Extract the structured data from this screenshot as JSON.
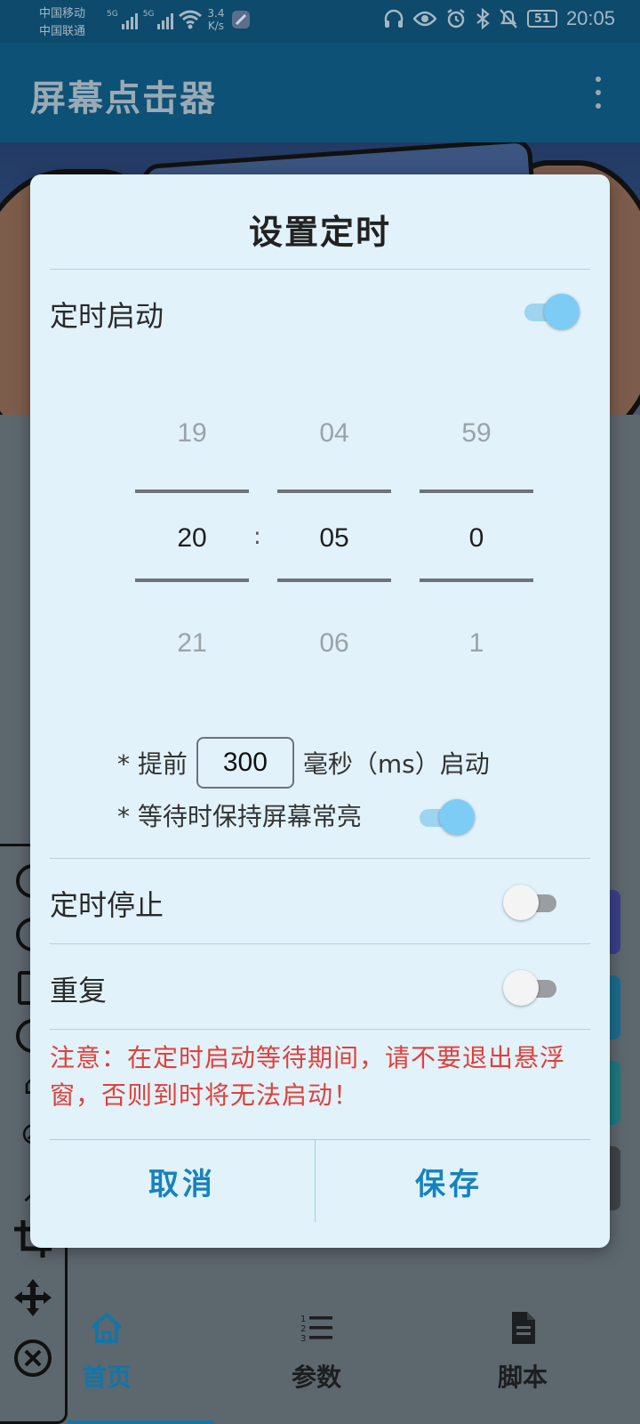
{
  "status_bar": {
    "carrier_1": "中国移动",
    "carrier_2": "中国联通",
    "net_1": "5G",
    "net_2": "5G",
    "speed_value": "3.4",
    "speed_unit": "K/s",
    "battery": "51",
    "time": "20:05",
    "icons": [
      "headphones-icon",
      "eye-icon",
      "alarm-icon",
      "bluetooth-icon",
      "mute-icon"
    ]
  },
  "app_bar": {
    "title": "屏幕点击器",
    "menu_icon": "more-vert-icon"
  },
  "dialog": {
    "title": "设置定时",
    "timed_start": {
      "label": "定时启动",
      "on": true
    },
    "picker": {
      "hours": {
        "above": "19",
        "selected": "20",
        "below": "21"
      },
      "minutes": {
        "above": "04",
        "selected": "05",
        "below": "06"
      },
      "seconds": {
        "above": "59",
        "selected": "0",
        "below": "1"
      },
      "separator": ":"
    },
    "advance": {
      "prefix": "* 提前",
      "value": "300",
      "suffix": "毫秒（ms）启动"
    },
    "keep_awake": {
      "label": "* 等待时保持屏幕常亮",
      "on": true
    },
    "timed_stop": {
      "label": "定时停止",
      "on": false
    },
    "repeat": {
      "label": "重复",
      "on": false
    },
    "warning": "注意：在定时启动等待期间，请不要退出悬浮窗，否则到时将无法启动！",
    "cancel_label": "取消",
    "save_label": "保存"
  },
  "bottom_nav": {
    "items": [
      {
        "label": "首页",
        "icon": "home-icon",
        "active": true
      },
      {
        "label": "参数",
        "icon": "numbered-list-icon",
        "active": false
      },
      {
        "label": "脚本",
        "icon": "document-icon",
        "active": false
      }
    ]
  },
  "colors": {
    "accent": "#1683bd",
    "switch_on": "#7dccf5",
    "warning": "#e0413a",
    "dialog_bg": "#e1f2fb"
  }
}
